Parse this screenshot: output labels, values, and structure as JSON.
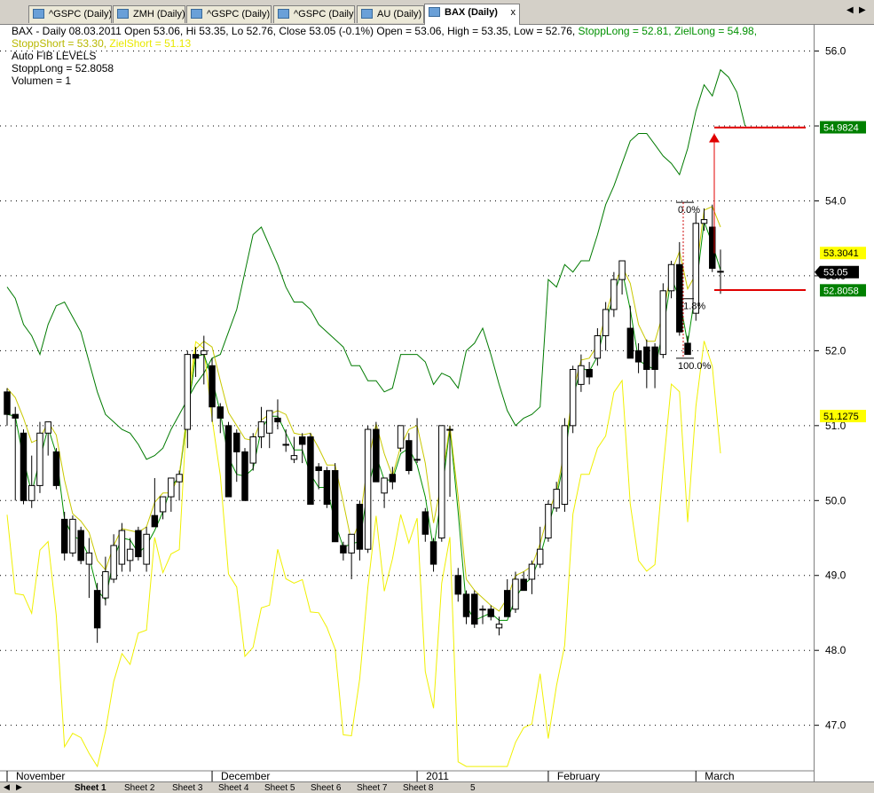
{
  "tabs": [
    {
      "label": "^GSPC (Daily)",
      "active": false
    },
    {
      "label": "ZMH (Daily)",
      "active": false
    },
    {
      "label": "^GSPC (Daily)",
      "active": false
    },
    {
      "label": "^GSPC (Daily)",
      "active": false
    },
    {
      "label": "AU (Daily)",
      "active": false
    },
    {
      "label": "BAX (Daily)",
      "active": true
    }
  ],
  "tab_close": "x",
  "scroll_left": "◀",
  "scroll_right": "▶",
  "info": {
    "line1_part1": "BAX - Daily 08.03.2011 Open 53.06, Hi 53.35, Lo 52.76, Close 53.05 (-0.1%) Open = 53.06, High = 53.35, Low = 52.76, ",
    "stopp_long": "StoppLong  = 52.81, ",
    "ziel_long": "ZielLong = 54.98,",
    "stopp_short": "StoppShort = 53.30, ",
    "ziel_short": "ZielShort = 51.13",
    "line3": "Auto FIB LEVELS",
    "line4": "StoppLong = 52.8058",
    "line5": "Volumen = 1"
  },
  "sheets": {
    "tabs": [
      "Sheet 1",
      "Sheet 2",
      "Sheet 3",
      "Sheet 4",
      "Sheet 5",
      "Sheet 6",
      "Sheet 7",
      "Sheet 8"
    ],
    "active_index": 0,
    "extra_label": "5",
    "nav_prev": "◀",
    "nav_next": "▶"
  },
  "chart_data": {
    "type": "candlestick",
    "ticker": "BAX",
    "ylim": [
      46.25,
      56.35
    ],
    "y_ticks": [
      47.0,
      48.0,
      49.0,
      50.0,
      51.0,
      52.0,
      53.0,
      54.0,
      55.0,
      56.0
    ],
    "x_labels": [
      "November",
      "December",
      "2011",
      "February",
      "March"
    ],
    "colors": {
      "ziel_long": "#007a00",
      "ziel_short": "#f0f000",
      "stopp_long": "#009000",
      "stopp_short": "#c8c800",
      "level_line": "#e00000",
      "current_price_bg": "#000000"
    },
    "candles": [
      {
        "o": 51.45,
        "h": 51.5,
        "l": 51.0,
        "c": 51.15
      },
      {
        "o": 51.15,
        "h": 51.25,
        "l": 50.0,
        "c": 51.1
      },
      {
        "o": 50.9,
        "h": 50.95,
        "l": 49.95,
        "c": 50.0
      },
      {
        "o": 50.0,
        "h": 50.6,
        "l": 49.9,
        "c": 50.2
      },
      {
        "o": 50.2,
        "h": 51.05,
        "l": 50.1,
        "c": 50.9
      },
      {
        "o": 50.9,
        "h": 51.05,
        "l": 50.6,
        "c": 51.05
      },
      {
        "o": 50.65,
        "h": 50.7,
        "l": 50.15,
        "c": 50.2
      },
      {
        "o": 49.75,
        "h": 49.85,
        "l": 49.2,
        "c": 49.3
      },
      {
        "o": 49.3,
        "h": 49.8,
        "l": 49.25,
        "c": 49.75
      },
      {
        "o": 49.6,
        "h": 49.65,
        "l": 49.15,
        "c": 49.2
      },
      {
        "o": 49.15,
        "h": 49.5,
        "l": 48.7,
        "c": 49.3
      },
      {
        "o": 48.8,
        "h": 48.9,
        "l": 48.1,
        "c": 48.3
      },
      {
        "o": 48.7,
        "h": 49.25,
        "l": 48.6,
        "c": 49.05
      },
      {
        "o": 48.95,
        "h": 49.55,
        "l": 48.9,
        "c": 49.4
      },
      {
        "o": 49.15,
        "h": 49.7,
        "l": 49.05,
        "c": 49.6
      },
      {
        "o": 49.2,
        "h": 49.5,
        "l": 49.05,
        "c": 49.35
      },
      {
        "o": 49.6,
        "h": 49.65,
        "l": 49.2,
        "c": 49.25
      },
      {
        "o": 49.15,
        "h": 49.65,
        "l": 49.05,
        "c": 49.55
      },
      {
        "o": 49.8,
        "h": 50.3,
        "l": 49.75,
        "c": 49.65
      },
      {
        "o": 49.85,
        "h": 49.9,
        "l": 49.75,
        "c": 50.05
      },
      {
        "o": 50.05,
        "h": 50.3,
        "l": 49.85,
        "c": 50.3
      },
      {
        "o": 50.25,
        "h": 50.4,
        "l": 50.0,
        "c": 50.35
      },
      {
        "o": 50.95,
        "h": 52.0,
        "l": 50.7,
        "c": 51.95
      },
      {
        "o": 51.95,
        "h": 52.05,
        "l": 51.65,
        "c": 51.9
      },
      {
        "o": 51.95,
        "h": 52.2,
        "l": 51.55,
        "c": 52.0
      },
      {
        "o": 51.8,
        "h": 51.9,
        "l": 51.05,
        "c": 51.25
      },
      {
        "o": 51.25,
        "h": 51.3,
        "l": 50.9,
        "c": 51.1
      },
      {
        "o": 51.0,
        "h": 51.05,
        "l": 50.05,
        "c": 50.05
      },
      {
        "o": 50.9,
        "h": 50.95,
        "l": 50.25,
        "c": 50.65
      },
      {
        "o": 50.65,
        "h": 50.7,
        "l": 50.0,
        "c": 50.0
      },
      {
        "o": 50.5,
        "h": 50.9,
        "l": 50.4,
        "c": 50.85
      },
      {
        "o": 50.85,
        "h": 51.25,
        "l": 50.7,
        "c": 51.05
      },
      {
        "o": 50.9,
        "h": 51.05,
        "l": 50.7,
        "c": 51.2
      },
      {
        "o": 51.1,
        "h": 51.35,
        "l": 50.95,
        "c": 51.05
      },
      {
        "o": 50.75,
        "h": 50.95,
        "l": 50.65,
        "c": 50.75
      },
      {
        "o": 50.55,
        "h": 50.85,
        "l": 50.5,
        "c": 50.6
      },
      {
        "o": 50.85,
        "h": 50.9,
        "l": 50.5,
        "c": 50.75
      },
      {
        "o": 50.85,
        "h": 50.9,
        "l": 49.95,
        "c": 49.95
      },
      {
        "o": 50.45,
        "h": 50.5,
        "l": 50.15,
        "c": 50.4
      },
      {
        "o": 50.4,
        "h": 50.45,
        "l": 49.9,
        "c": 49.95
      },
      {
        "o": 50.4,
        "h": 50.5,
        "l": 49.45,
        "c": 49.45
      },
      {
        "o": 49.4,
        "h": 49.45,
        "l": 49.2,
        "c": 49.3
      },
      {
        "o": 49.3,
        "h": 49.45,
        "l": 48.95,
        "c": 49.55
      },
      {
        "o": 49.95,
        "h": 50.0,
        "l": 49.2,
        "c": 49.35
      },
      {
        "o": 49.35,
        "h": 51.0,
        "l": 49.3,
        "c": 50.95
      },
      {
        "o": 50.95,
        "h": 51.05,
        "l": 50.25,
        "c": 50.25
      },
      {
        "o": 50.1,
        "h": 50.2,
        "l": 49.9,
        "c": 50.3
      },
      {
        "o": 50.35,
        "h": 50.45,
        "l": 50.15,
        "c": 50.25
      },
      {
        "o": 50.7,
        "h": 51.0,
        "l": 50.65,
        "c": 51.0
      },
      {
        "o": 50.8,
        "h": 50.9,
        "l": 50.35,
        "c": 50.4
      },
      {
        "o": 50.55,
        "h": 51.1,
        "l": 50.5,
        "c": 50.55
      },
      {
        "o": 49.85,
        "h": 49.9,
        "l": 49.45,
        "c": 49.55
      },
      {
        "o": 49.45,
        "h": 49.5,
        "l": 49.05,
        "c": 49.15
      },
      {
        "o": 49.5,
        "h": 51.0,
        "l": 49.45,
        "c": 51.0
      },
      {
        "o": 50.95,
        "h": 51.0,
        "l": 50.05,
        "c": 50.95
      },
      {
        "o": 49.0,
        "h": 49.1,
        "l": 48.65,
        "c": 48.75
      },
      {
        "o": 48.75,
        "h": 48.8,
        "l": 48.35,
        "c": 48.45
      },
      {
        "o": 48.75,
        "h": 48.8,
        "l": 48.3,
        "c": 48.35
      },
      {
        "o": 48.55,
        "h": 48.6,
        "l": 48.35,
        "c": 48.55
      },
      {
        "o": 48.55,
        "h": 48.6,
        "l": 48.4,
        "c": 48.45
      },
      {
        "o": 48.3,
        "h": 48.45,
        "l": 48.2,
        "c": 48.35
      },
      {
        "o": 48.8,
        "h": 48.95,
        "l": 48.45,
        "c": 48.45
      },
      {
        "o": 48.55,
        "h": 49.05,
        "l": 48.5,
        "c": 48.95
      },
      {
        "o": 48.95,
        "h": 49.05,
        "l": 48.8,
        "c": 48.8
      },
      {
        "o": 48.95,
        "h": 49.2,
        "l": 48.75,
        "c": 49.15
      },
      {
        "o": 49.15,
        "h": 49.65,
        "l": 49.1,
        "c": 49.35
      },
      {
        "o": 49.5,
        "h": 50.0,
        "l": 49.45,
        "c": 49.95
      },
      {
        "o": 49.9,
        "h": 50.25,
        "l": 49.85,
        "c": 50.15
      },
      {
        "o": 49.95,
        "h": 51.1,
        "l": 49.85,
        "c": 51.0
      },
      {
        "o": 51.0,
        "h": 51.8,
        "l": 50.9,
        "c": 51.75
      },
      {
        "o": 51.55,
        "h": 51.95,
        "l": 51.45,
        "c": 51.8
      },
      {
        "o": 51.75,
        "h": 51.85,
        "l": 51.55,
        "c": 51.65
      },
      {
        "o": 51.9,
        "h": 52.3,
        "l": 51.8,
        "c": 52.2
      },
      {
        "o": 52.2,
        "h": 52.65,
        "l": 52.0,
        "c": 52.55
      },
      {
        "o": 52.55,
        "h": 53.05,
        "l": 52.45,
        "c": 52.95
      },
      {
        "o": 52.95,
        "h": 53.2,
        "l": 52.75,
        "c": 53.2
      },
      {
        "o": 52.3,
        "h": 52.6,
        "l": 51.9,
        "c": 51.9
      },
      {
        "o": 52.0,
        "h": 52.1,
        "l": 51.7,
        "c": 51.85
      },
      {
        "o": 52.05,
        "h": 52.15,
        "l": 51.5,
        "c": 51.75
      },
      {
        "o": 52.05,
        "h": 52.1,
        "l": 51.5,
        "c": 51.75
      },
      {
        "o": 51.95,
        "h": 52.9,
        "l": 51.9,
        "c": 52.8
      },
      {
        "o": 52.8,
        "h": 53.2,
        "l": 52.7,
        "c": 53.15
      },
      {
        "o": 53.15,
        "h": 53.45,
        "l": 52.2,
        "c": 52.25
      },
      {
        "o": 52.1,
        "h": 52.2,
        "l": 51.95,
        "c": 51.95
      },
      {
        "o": 52.5,
        "h": 53.85,
        "l": 52.4,
        "c": 53.7
      },
      {
        "o": 53.7,
        "h": 53.9,
        "l": 53.6,
        "c": 53.75
      },
      {
        "o": 53.65,
        "h": 53.95,
        "l": 53.05,
        "c": 53.1
      },
      {
        "o": 53.06,
        "h": 53.35,
        "l": 52.76,
        "c": 53.05
      }
    ],
    "ziel_long": [
      52.85,
      52.7,
      52.35,
      52.2,
      51.95,
      52.35,
      52.6,
      52.65,
      52.45,
      52.25,
      51.85,
      51.45,
      51.15,
      51.05,
      50.95,
      50.9,
      50.75,
      50.55,
      50.6,
      50.7,
      50.95,
      51.15,
      51.35,
      51.55,
      51.7,
      51.9,
      51.95,
      52.25,
      52.55,
      53.05,
      53.55,
      53.65,
      53.4,
      53.15,
      52.85,
      52.65,
      52.65,
      52.55,
      52.35,
      52.25,
      52.15,
      52.05,
      51.8,
      51.8,
      51.6,
      51.6,
      51.45,
      51.5,
      51.95,
      51.95,
      51.95,
      51.85,
      51.55,
      51.7,
      51.65,
      51.5,
      52.0,
      52.1,
      52.3,
      51.95,
      51.55,
      51.2,
      51.0,
      51.1,
      51.15,
      51.25,
      52.95,
      52.85,
      53.15,
      53.05,
      53.2,
      53.2,
      53.55,
      53.95,
      54.2,
      54.5,
      54.8,
      54.9,
      54.9,
      54.75,
      54.6,
      54.5,
      54.35,
      54.7,
      55.2,
      55.55,
      55.4,
      55.75,
      55.65,
      55.45,
      55.0
    ]
  }
}
